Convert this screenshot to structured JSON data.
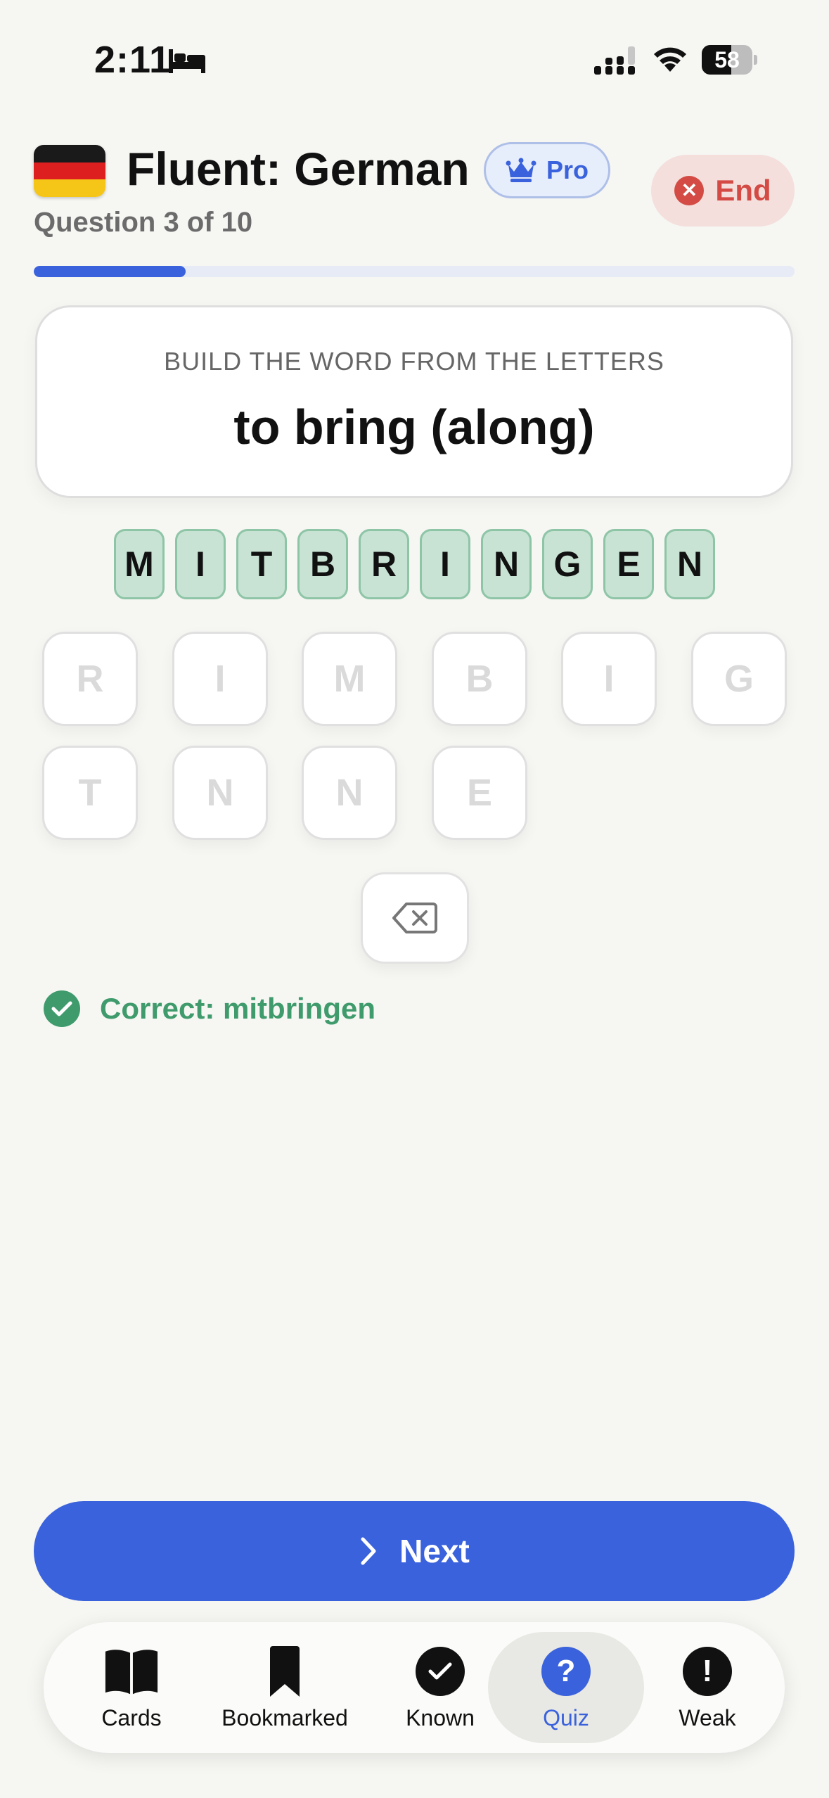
{
  "status_bar": {
    "time": "2:11",
    "battery_level": "58",
    "battery_fraction": 0.58
  },
  "header": {
    "title": "Fluent: German",
    "pro_label": "Pro",
    "question_counter": "Question 3 of 10",
    "end_label": "End",
    "progress_fraction": 0.2
  },
  "prompt": {
    "instruction": "BUILD THE WORD FROM THE LETTERS",
    "word": "to bring (along)"
  },
  "answer_letters": [
    "M",
    "I",
    "T",
    "B",
    "R",
    "I",
    "N",
    "G",
    "E",
    "N"
  ],
  "letter_pool": [
    "R",
    "I",
    "M",
    "B",
    "I",
    "G",
    "T",
    "N",
    "N",
    "E"
  ],
  "feedback": {
    "text": "Correct: mitbringen"
  },
  "next_button": {
    "label": "Next"
  },
  "tabs": [
    {
      "label": "Cards",
      "icon": "book-icon"
    },
    {
      "label": "Bookmarked",
      "icon": "bookmark-icon"
    },
    {
      "label": "Known",
      "icon": "check-circle-icon"
    },
    {
      "label": "Quiz",
      "icon": "question-circle-icon",
      "active": true
    },
    {
      "label": "Weak",
      "icon": "exclamation-circle-icon"
    }
  ],
  "colors": {
    "accent": "#3a62dc",
    "success": "#3f9b6c",
    "danger": "#d34b44",
    "tile_correct_bg": "#c8e3d4",
    "flag_black": "#1a1a1a",
    "flag_red": "#dd1f1f",
    "flag_gold": "#f5c518"
  }
}
